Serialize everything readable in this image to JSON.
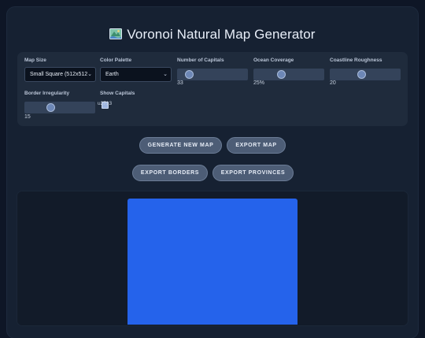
{
  "header": {
    "icon": "map-icon",
    "title": "Voronoi Natural Map Generator"
  },
  "controls": {
    "map_size": {
      "label": "Map Size",
      "value": "Small Square (512x512"
    },
    "color_palette": {
      "label": "Color Palette",
      "value": "Earth"
    },
    "capitals": {
      "label": "Number of Capitals",
      "value": "33",
      "level": 0.2
    },
    "ocean": {
      "label": "Ocean Coverage",
      "value": "25%",
      "level": 0.35
    },
    "coastline": {
      "label": "Coastline Roughness",
      "value": "20",
      "level": 0.45
    },
    "border": {
      "label": "Border Irregularity",
      "value": "15",
      "level": 0.35
    },
    "show_capitals": {
      "label": "Show Capitals",
      "checkbox_text": "u2713",
      "checked": true
    }
  },
  "buttons": {
    "generate": "Generate New Map",
    "export_map": "Export Map",
    "export_borders": "Export Borders",
    "export_provinces": "Export Provinces"
  },
  "colors": {
    "map_fill": "#2563eb",
    "page_bg": "#0e1626",
    "panel_bg": "#1f2b3c",
    "button_bg": "#4d5d76"
  }
}
